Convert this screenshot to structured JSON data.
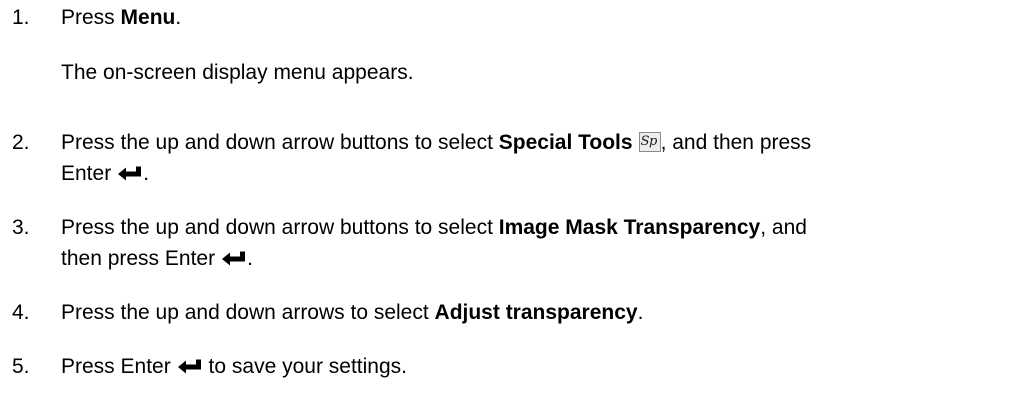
{
  "steps": [
    {
      "number": "1.",
      "text_before": "Press ",
      "bold": "Menu",
      "text_after": "."
    },
    {
      "note": "The on-screen display menu appears."
    },
    {
      "number": "2.",
      "text_before": "Press the up and down arrow buttons to select ",
      "bold": "Special Tools",
      "icon_label": "Sp",
      "text_after": ", and then press",
      "line2_before": "Enter",
      "line2_after": "."
    },
    {
      "number": "3.",
      "text_before": "Press the up and down arrow buttons to select ",
      "bold": "Image Mask Transparency",
      "text_after": ", and",
      "line2_before": "then press Enter",
      "line2_after": "."
    },
    {
      "number": "4.",
      "text_before": "Press the up and down arrows to select ",
      "bold": "Adjust transparency",
      "text_after": "."
    },
    {
      "number": "5.",
      "text_before": "Press Enter",
      "text_after": " to save your settings."
    }
  ],
  "icons": {
    "special_tools": "special-tools-icon",
    "enter": "enter-arrow-icon"
  }
}
